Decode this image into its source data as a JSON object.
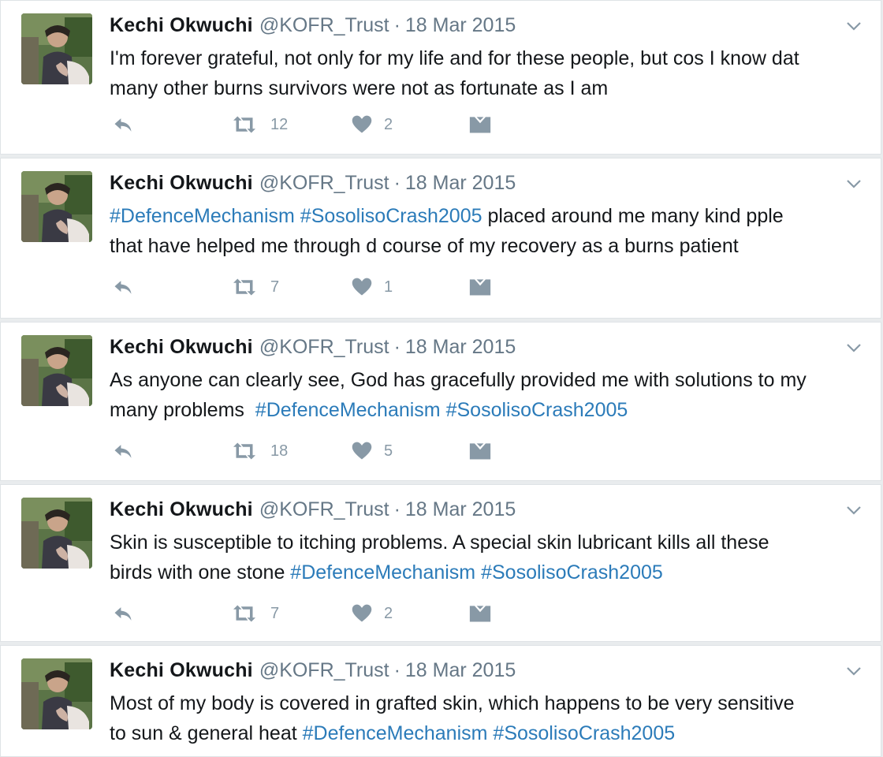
{
  "tweets": [
    {
      "name": "Kechi Okwuchi",
      "handle": "@KOFR_Trust",
      "separator": "·",
      "date": "18 Mar 2015",
      "line1": "I'm forever grateful, not only for my life and for these people, but cos I know dat",
      "line2": "many other burns survivors were not as fortunate as I am",
      "retweets": "12",
      "likes": "2"
    },
    {
      "name": "Kechi Okwuchi",
      "handle": "@KOFR_Trust",
      "separator": "·",
      "date": "18 Mar 2015",
      "tag1": "#DefenceMechanism",
      "tag2": "#SosolisoCrash2005",
      "line1_rest": " placed around me many kind pple",
      "line2": "that have helped me through d course of my recovery as a burns patient",
      "retweets": "7",
      "likes": "1"
    },
    {
      "name": "Kechi Okwuchi",
      "handle": "@KOFR_Trust",
      "separator": "·",
      "date": "18 Mar 2015",
      "line1": "As anyone can clearly see, God has gracefully provided me with solutions to my",
      "line2_text": "many problems  ",
      "tag1": "#DefenceMechanism",
      "tag2": "#SosolisoCrash2005",
      "retweets": "18",
      "likes": "5"
    },
    {
      "name": "Kechi Okwuchi",
      "handle": "@KOFR_Trust",
      "separator": "·",
      "date": "18 Mar 2015",
      "line1": "Skin is susceptible to itching problems. A special skin lubricant kills all these",
      "line2_text": "birds with one stone ",
      "tag1": "#DefenceMechanism",
      "tag2": "#SosolisoCrash2005",
      "retweets": "7",
      "likes": "2"
    },
    {
      "name": "Kechi Okwuchi",
      "handle": "@KOFR_Trust",
      "separator": "·",
      "date": "18 Mar 2015",
      "line1": "Most of my body is covered in grafted skin, which happens to be very sensitive",
      "line2_text": "to sun & general heat ",
      "tag1": "#DefenceMechanism",
      "tag2": "#SosolisoCrash2005"
    }
  ],
  "icons": {
    "reply": "reply-icon",
    "retweet": "retweet-icon",
    "like": "heart-icon",
    "dm": "direct-message-icon",
    "caret": "chevron-down-icon"
  },
  "colors": {
    "hashtag": "#2b7bb9",
    "muted": "#8899a6",
    "meta": "#657786",
    "text": "#14171a"
  }
}
